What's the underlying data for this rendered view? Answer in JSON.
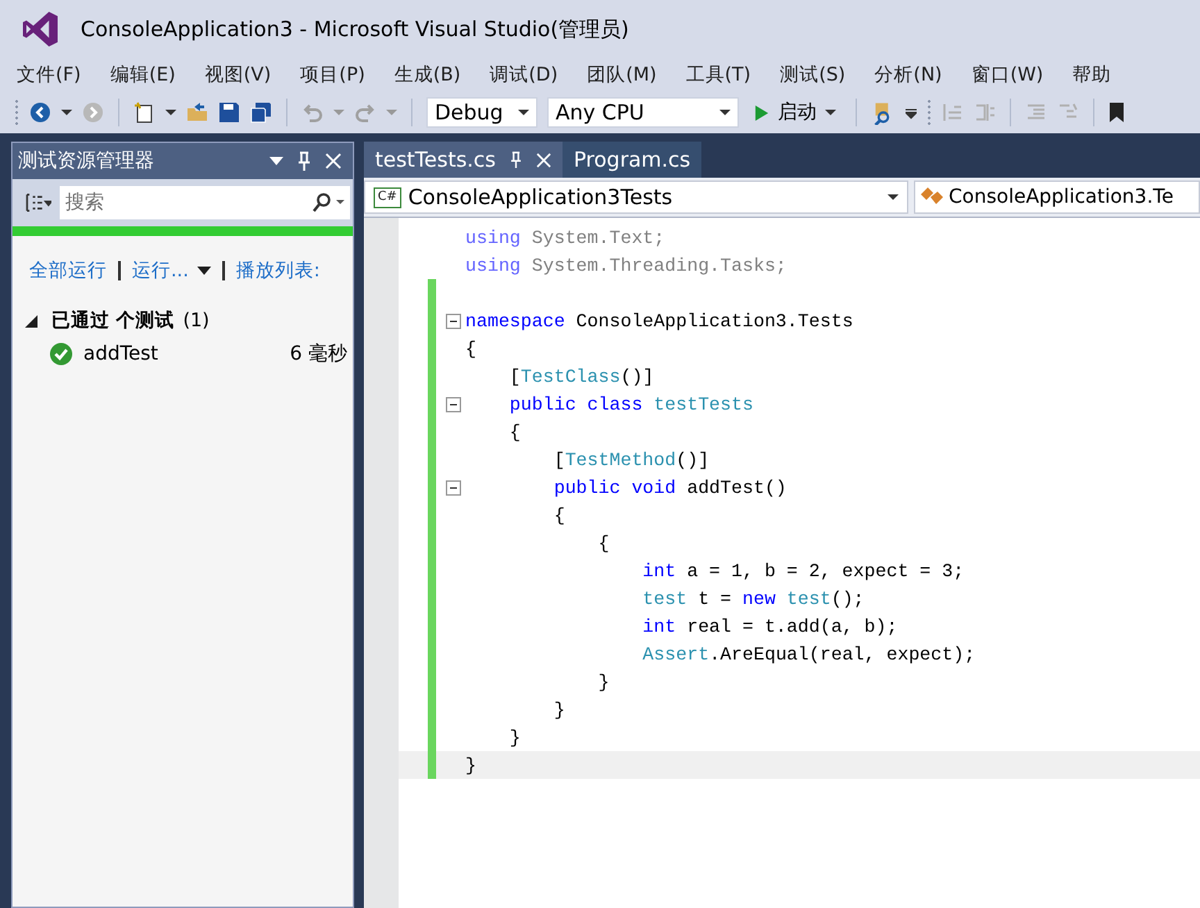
{
  "window": {
    "title": "ConsoleApplication3 - Microsoft Visual Studio(管理员)"
  },
  "menu": [
    "文件(F)",
    "编辑(E)",
    "视图(V)",
    "项目(P)",
    "生成(B)",
    "调试(D)",
    "团队(M)",
    "工具(T)",
    "测试(S)",
    "分析(N)",
    "窗口(W)",
    "帮助"
  ],
  "toolbar": {
    "configuration": "Debug",
    "platform": "Any CPU",
    "start_label": "启动"
  },
  "test_explorer": {
    "title": "测试资源管理器",
    "search": {
      "placeholder": "搜索"
    },
    "progress": {
      "level": 1
    },
    "actions": [
      {
        "label": "全部运行",
        "dropdown": false
      },
      {
        "label": "运行...",
        "dropdown": true
      },
      {
        "label": "播放列表:",
        "dropdown": false
      }
    ],
    "group": {
      "label": "已通过 个测试",
      "count": "(1)",
      "expanded": true
    },
    "tests": [
      {
        "name": "addTest",
        "passed": true,
        "duration": "6 毫秒"
      }
    ]
  },
  "tabs": [
    {
      "label": "testTests.cs",
      "selected": true
    },
    {
      "label": "Program.cs",
      "selected": false
    }
  ],
  "nav_bar": {
    "project_icon": "C#",
    "project": "ConsoleApplication3Tests",
    "type": "ConsoleApplication3.Te"
  },
  "code": [
    {
      "fold": false,
      "changed": false,
      "dim": true,
      "tokens": [
        {
          "kind": "keyword",
          "text": "using"
        },
        {
          "kind": "plain",
          "text": " System.Text;"
        }
      ]
    },
    {
      "fold": false,
      "changed": false,
      "dim": true,
      "tokens": [
        {
          "kind": "keyword",
          "text": "using"
        },
        {
          "kind": "plain",
          "text": " System.Threading.Tasks;"
        }
      ]
    },
    {
      "fold": false,
      "changed": true
    },
    {
      "fold": true,
      "changed": true,
      "dim": false,
      "tokens": [
        {
          "kind": "keyword",
          "text": "namespace"
        },
        {
          "kind": "plain",
          "text": " ConsoleApplication3.Tests"
        }
      ]
    },
    {
      "fold": false,
      "changed": true,
      "dim": false,
      "tokens": [
        {
          "kind": "plain",
          "text": "{"
        }
      ]
    },
    {
      "fold": false,
      "changed": true,
      "dim": false,
      "tokens": [
        {
          "kind": "plain",
          "text": "    ["
        },
        {
          "kind": "type",
          "text": "TestClass"
        },
        {
          "kind": "plain",
          "text": "()]"
        }
      ]
    },
    {
      "fold": true,
      "changed": true,
      "dim": false,
      "tokens": [
        {
          "kind": "keyword",
          "text": "    public class "
        },
        {
          "kind": "type",
          "text": "testTests"
        }
      ]
    },
    {
      "fold": false,
      "changed": true,
      "dim": false,
      "tokens": [
        {
          "kind": "plain",
          "text": "    {"
        }
      ]
    },
    {
      "fold": false,
      "changed": true,
      "dim": false,
      "tokens": [
        {
          "kind": "plain",
          "text": "        ["
        },
        {
          "kind": "type",
          "text": "TestMethod"
        },
        {
          "kind": "plain",
          "text": "()]"
        }
      ]
    },
    {
      "fold": true,
      "changed": true,
      "dim": false,
      "tokens": [
        {
          "kind": "keyword",
          "text": "        public void"
        },
        {
          "kind": "plain",
          "text": " addTest()"
        }
      ]
    },
    {
      "fold": false,
      "changed": true,
      "dim": false,
      "tokens": [
        {
          "kind": "plain",
          "text": "        {"
        }
      ]
    },
    {
      "fold": false,
      "changed": true,
      "dim": false,
      "tokens": [
        {
          "kind": "plain",
          "text": "            {"
        }
      ]
    },
    {
      "fold": false,
      "changed": true,
      "dim": false,
      "tokens": [
        {
          "kind": "keyword",
          "text": "                int"
        },
        {
          "kind": "plain",
          "text": " a = 1, b = 2, expect = 3;"
        }
      ]
    },
    {
      "fold": false,
      "changed": true,
      "dim": false,
      "tokens": [
        {
          "kind": "type",
          "text": "                test"
        },
        {
          "kind": "plain",
          "text": " t = "
        },
        {
          "kind": "keyword",
          "text": "new "
        },
        {
          "kind": "type",
          "text": "test"
        },
        {
          "kind": "plain",
          "text": "();"
        }
      ]
    },
    {
      "fold": false,
      "changed": true,
      "dim": false,
      "tokens": [
        {
          "kind": "keyword",
          "text": "                int"
        },
        {
          "kind": "plain",
          "text": " real = t.add(a, b);"
        }
      ]
    },
    {
      "fold": false,
      "changed": true,
      "dim": false,
      "tokens": [
        {
          "kind": "type",
          "text": "                Assert"
        },
        {
          "kind": "plain",
          "text": ".AreEqual(real, expect);"
        }
      ]
    },
    {
      "fold": false,
      "changed": true,
      "dim": false,
      "tokens": [
        {
          "kind": "plain",
          "text": "            }"
        }
      ]
    },
    {
      "fold": false,
      "changed": true,
      "dim": false,
      "tokens": [
        {
          "kind": "plain",
          "text": "        }"
        }
      ]
    },
    {
      "fold": false,
      "changed": true,
      "dim": false,
      "tokens": [
        {
          "kind": "plain",
          "text": "    }"
        }
      ]
    },
    {
      "fold": false,
      "changed": true,
      "dim": false,
      "tokens": [
        {
          "kind": "plain",
          "text": "}"
        }
      ]
    }
  ]
}
